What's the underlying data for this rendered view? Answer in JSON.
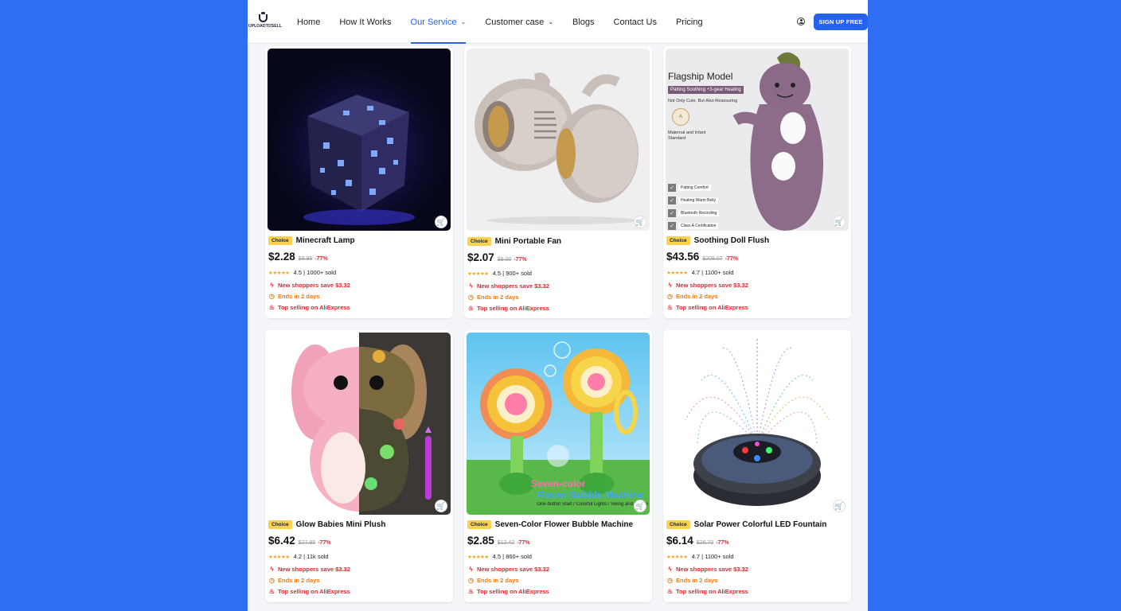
{
  "header": {
    "logo_text": "UPLOADTOSELL",
    "nav": [
      {
        "label": "Home",
        "caret": ""
      },
      {
        "label": "How It Works",
        "caret": ""
      },
      {
        "label": "Our Service",
        "caret": "⌄"
      },
      {
        "label": "Customer case",
        "caret": "⌄"
      },
      {
        "label": "Blogs",
        "caret": ""
      },
      {
        "label": "Contact Us",
        "caret": ""
      },
      {
        "label": "Pricing",
        "caret": ""
      }
    ],
    "active_nav": "Our Service",
    "signup_label": "SIGN UP FREE"
  },
  "common": {
    "badge": "Choice",
    "promo": "New shoppers save $3.32",
    "ends": "Ends in 2 days",
    "top": "Top selling on AliExpress"
  },
  "products": [
    {
      "name": "Minecraft Lamp",
      "price": "$2.28",
      "old": "$9.95",
      "discount": "-77%",
      "rating": "4.5",
      "sold": "1000+ sold",
      "stars": "★★★★★"
    },
    {
      "name": "Mini Portable Fan",
      "price": "$2.07",
      "old": "$9.00",
      "discount": "-77%",
      "rating": "4.5",
      "sold": "900+ sold",
      "stars": "★★★★★"
    },
    {
      "name": "Soothing Doll Flush",
      "price": "$43.56",
      "old": "$208.07",
      "discount": "-77%",
      "rating": "4.7",
      "sold": "1100+ sold",
      "stars": "★★★★★",
      "overlay": {
        "title": "Flagship Model",
        "sub": "Patting Soothing +3-gear Heating",
        "desc": "Not Only Cute, But Also Reassuring",
        "cert": "Maternal and Infant Standard",
        "features": [
          "Patting Comfort",
          "Heating Warm Belly",
          "Bluetooth Recording",
          "Class A Certification"
        ]
      }
    },
    {
      "name": "Glow Babies Mini Plush",
      "price": "$6.42",
      "old": "$27.95",
      "discount": "-77%",
      "rating": "4.2",
      "sold": "11k sold",
      "stars": "★★★★★"
    },
    {
      "name": "Seven-Color Flower Bubble Machine",
      "price": "$2.85",
      "old": "$12.42",
      "discount": "-77%",
      "rating": "4.5",
      "sold": "860+ sold",
      "stars": "★★★★★",
      "overlay": {
        "line1": "Seven-color",
        "line2": "Flower Bubble Machine",
        "line3": "One-button Start / Colorful Lights / Swing and Dance"
      }
    },
    {
      "name": "Solar Power Colorful LED Fountain",
      "price": "$6.14",
      "old": "$26.70",
      "discount": "-77%",
      "rating": "4.7",
      "sold": "1100+ sold",
      "stars": "★★★★★"
    }
  ]
}
